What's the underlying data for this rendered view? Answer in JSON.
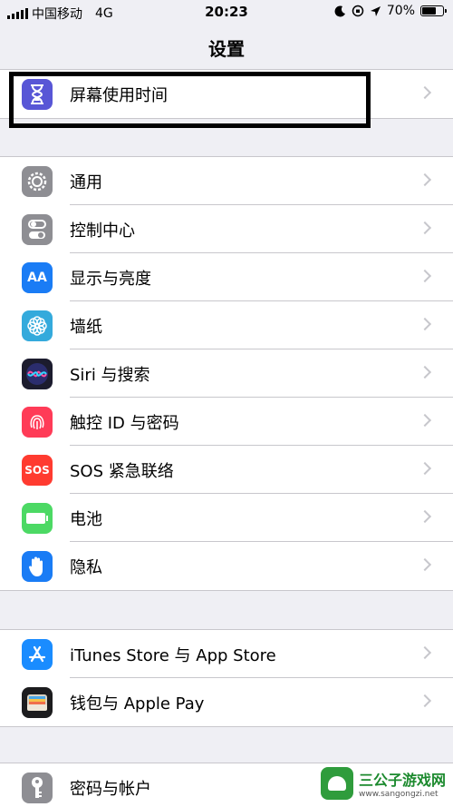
{
  "status_bar": {
    "carrier": "中国移动",
    "network": "4G",
    "time": "20:23",
    "battery": "70%",
    "battery_level": 0.7
  },
  "title": "设置",
  "groups": [
    {
      "items": [
        {
          "label": "屏幕使用时间",
          "icon": "hourglass-icon",
          "color": "#5856d6"
        }
      ]
    },
    {
      "items": [
        {
          "label": "通用",
          "icon": "gear-icon",
          "color": "#8e8e93"
        },
        {
          "label": "控制中心",
          "icon": "toggles-icon",
          "color": "#8e8e93"
        },
        {
          "label": "显示与亮度",
          "icon": "display-aa-icon",
          "color": "#1a7cf5",
          "glyph": "AA"
        },
        {
          "label": "墙纸",
          "icon": "flower-icon",
          "color": "#34aadc"
        },
        {
          "label": "Siri 与搜索",
          "icon": "siri-icon",
          "color": "#1c1c2e"
        },
        {
          "label": "触控 ID 与密码",
          "icon": "fingerprint-icon",
          "color": "#ff3b57"
        },
        {
          "label": "SOS 紧急联络",
          "icon": "sos-icon",
          "color": "#ff3b30",
          "glyph": "SOS"
        },
        {
          "label": "电池",
          "icon": "battery-icon",
          "color": "#4cd964"
        },
        {
          "label": "隐私",
          "icon": "hand-icon",
          "color": "#1a7cf5"
        }
      ]
    },
    {
      "items": [
        {
          "label": "iTunes Store 与 App Store",
          "icon": "app-store-icon",
          "color": "#1a8cff"
        },
        {
          "label": "钱包与 Apple Pay",
          "icon": "wallet-icon",
          "color": "#1c1c1e"
        }
      ]
    },
    {
      "items": [
        {
          "label": "密码与帐户",
          "icon": "key-icon",
          "color": "#8e8e93"
        }
      ]
    }
  ],
  "watermark": {
    "title": "三公子游戏网",
    "url": "www.sangongzi.net"
  }
}
